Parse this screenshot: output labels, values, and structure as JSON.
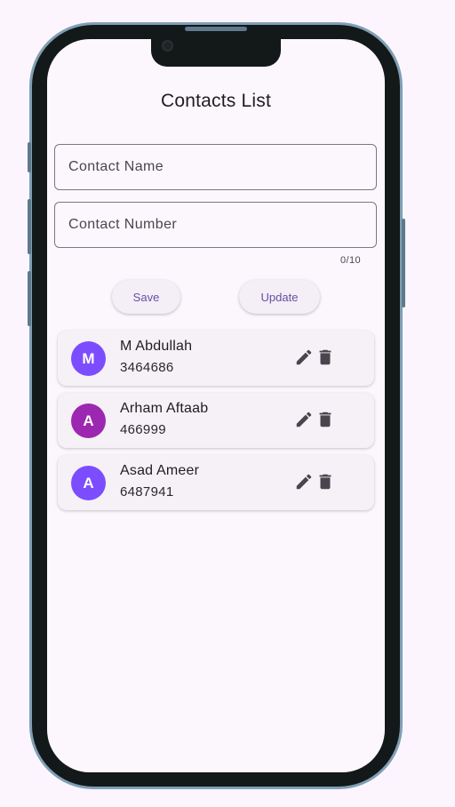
{
  "app": {
    "title": "Contacts List"
  },
  "form": {
    "name_placeholder": "Contact Name",
    "number_placeholder": "Contact Number",
    "counter": "0/10",
    "save_label": "Save",
    "update_label": "Update"
  },
  "contacts": [
    {
      "initial": "M",
      "name": "M Abdullah",
      "number": "3464686",
      "avatar_color": "#7c4dff"
    },
    {
      "initial": "A",
      "name": "Arham Aftaab",
      "number": "466999",
      "avatar_color": "#9c27b0"
    },
    {
      "initial": "A",
      "name": "Asad Ameer",
      "number": "6487941",
      "avatar_color": "#7c4dff"
    }
  ],
  "icons": {
    "edit": "edit-icon",
    "delete": "delete-icon"
  },
  "colors": {
    "accent": "#6750a4",
    "background": "#fcf7fd",
    "card": "#f5f1f6",
    "icon": "#49454f"
  }
}
